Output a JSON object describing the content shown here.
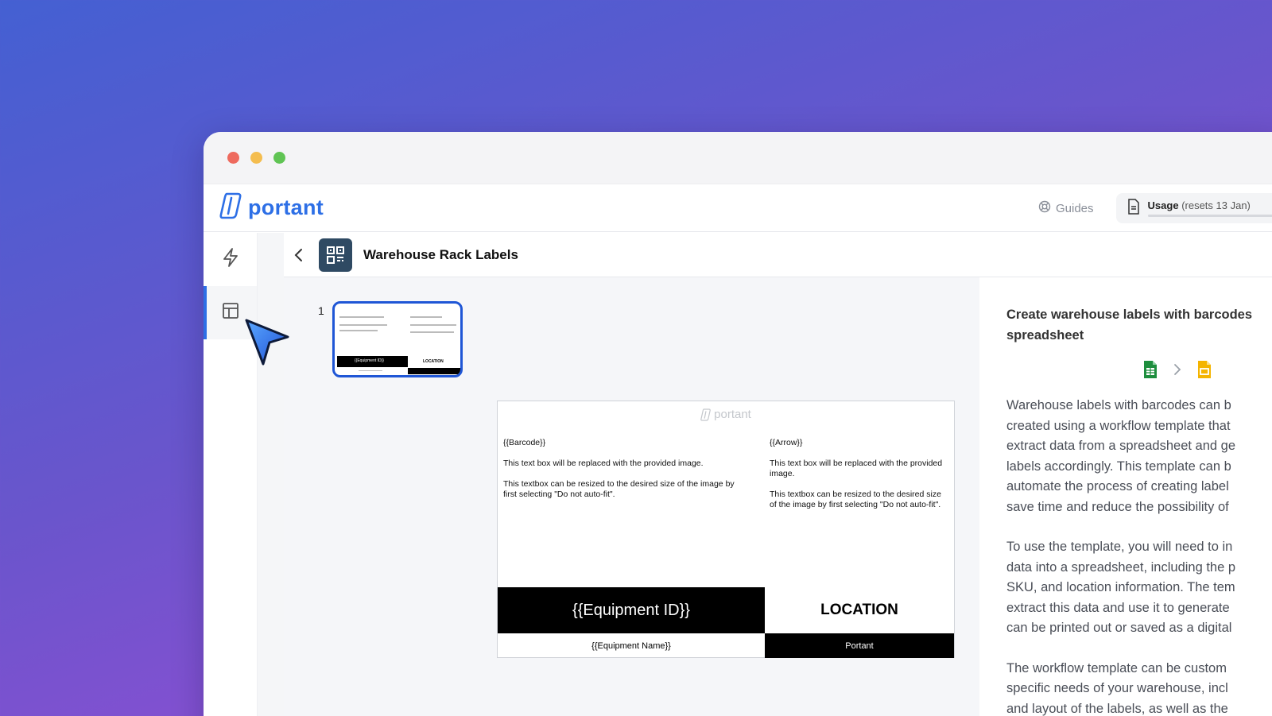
{
  "brand": {
    "name": "portant"
  },
  "nav": {
    "guides_label": "Guides",
    "usage_label": "Usage",
    "usage_sub": "(resets 13 Jan)"
  },
  "header": {
    "title": "Warehouse Rack Labels"
  },
  "thumbnail": {
    "page_number": "1",
    "id_label": "{{Equipment ID}}",
    "location_label": "LOCATION"
  },
  "label_page": {
    "logo_text": "portant",
    "left": {
      "placeholder": "{{Barcode}}",
      "line1": "This text box will be replaced with the provided image.",
      "line2": "This textbox can be resized to the desired size of the image by first selecting \"Do not auto-fit\"."
    },
    "right": {
      "placeholder": "{{Arrow}}",
      "line1": "This text box will be replaced with the provided image.",
      "line2": "This textbox can be resized to the desired size of the image by first selecting \"Do not auto-fit\"."
    },
    "equipment_id": "{{Equipment ID}}",
    "location": "LOCATION",
    "equipment_name": "{{Equipment Name}}",
    "footer_brand": "Portant"
  },
  "panel": {
    "title_line1": "Create warehouse labels with barcodes",
    "title_line2": "spreadsheet",
    "paragraph1": [
      "Warehouse labels with barcodes can b",
      "created using a workflow template that",
      "extract data from a spreadsheet and ge",
      "labels accordingly. This template can b",
      "automate the process of creating label",
      "save time and reduce the possibility of"
    ],
    "paragraph2": [
      "To use the template, you will need to in",
      "data into a spreadsheet, including the p",
      "SKU, and location information. The tem",
      "extract this data and use it to generate",
      "can be printed out or saved as a digital"
    ],
    "paragraph3": [
      "The workflow template can be custom",
      "specific needs of your warehouse, incl",
      "and layout of the labels, as well as the"
    ]
  },
  "colors": {
    "brand_blue": "#2d6fe6",
    "template_icon_bg": "#2f4a63",
    "sheets_green": "#1e8e3e",
    "slides_yellow": "#f4b400"
  },
  "icons": {
    "sidebar": [
      "lightning-icon",
      "layout-icon"
    ],
    "nav": [
      "lifebuoy-icon",
      "document-icon"
    ],
    "flow": [
      "google-sheets-icon",
      "chevron-right-icon",
      "google-slides-icon"
    ]
  }
}
